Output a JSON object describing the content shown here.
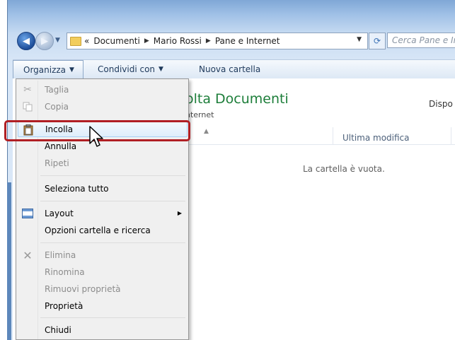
{
  "window": {
    "breadcrumb": [
      "Documenti",
      "Mario Rossi",
      "Pane e Internet"
    ],
    "breadcrumb_overflow": "«",
    "search_placeholder": "Cerca Pane e Inter"
  },
  "toolbar": {
    "organize": "Organizza",
    "share": "Condividi con",
    "new_folder": "Nuova cartella"
  },
  "content": {
    "library_title": "olta Documenti",
    "library_subtitle": "nternet",
    "dispo_label": "Dispo",
    "column_modified": "Ultima modifica",
    "empty_message": "La cartella è vuota."
  },
  "menu": {
    "items": [
      {
        "label": "Taglia",
        "enabled": false,
        "icon": "scissors-icon"
      },
      {
        "label": "Copia",
        "enabled": false,
        "icon": "copy-icon"
      },
      {
        "label": "Incolla",
        "enabled": true,
        "icon": "paste-icon",
        "highlighted": true
      },
      {
        "label": "Annulla",
        "enabled": true
      },
      {
        "label": "Ripeti",
        "enabled": false
      },
      {
        "label": "Seleziona tutto",
        "enabled": true
      },
      {
        "label": "Layout",
        "enabled": true,
        "icon": "layout-icon",
        "submenu": true
      },
      {
        "label": "Opzioni cartella e ricerca",
        "enabled": true
      },
      {
        "label": "Elimina",
        "enabled": false,
        "icon": "delete-icon"
      },
      {
        "label": "Rinomina",
        "enabled": false
      },
      {
        "label": "Rimuovi proprietà",
        "enabled": false
      },
      {
        "label": "Proprietà",
        "enabled": true
      },
      {
        "label": "Chiudi",
        "enabled": true
      }
    ]
  },
  "colors": {
    "library_title": "#1d7e3a",
    "highlight_box": "#b01f24",
    "menu_bg": "#f0f0f0"
  }
}
